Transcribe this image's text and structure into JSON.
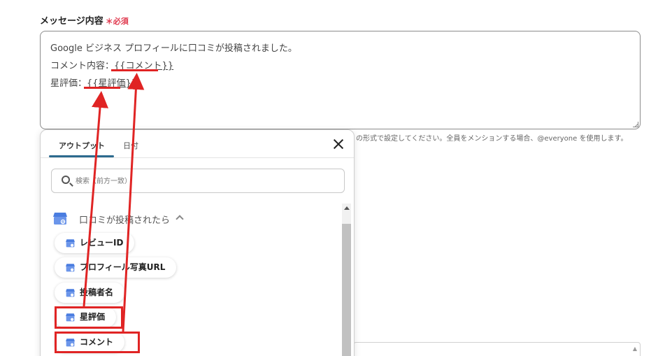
{
  "field": {
    "label": "メッセージ内容",
    "required": "＊必須"
  },
  "message": {
    "line1": "Google ビジネス プロフィールに口コミが投稿されました。",
    "line2_prefix": "コメント内容：",
    "line2_var": "{{コメント}}",
    "line3_prefix": "星評価：",
    "line3_var": "{{星評価}}"
  },
  "help_text": "の形式で設定してください。全員をメンションする場合、@everyone を使用します。",
  "popup": {
    "tabs": [
      "アウトプット",
      "日付"
    ],
    "search_placeholder": "検索（前方一致）",
    "group_label": "口コミが投稿されたら",
    "items": [
      "レビューID",
      "プロフィール写真URL",
      "投稿者名",
      "星評価",
      "コメント"
    ]
  },
  "colors": {
    "accent": "#2c6a8e",
    "annotation": "#e02424",
    "required": "#e0394e",
    "gbp_icon_blue": "#4a7de0"
  }
}
